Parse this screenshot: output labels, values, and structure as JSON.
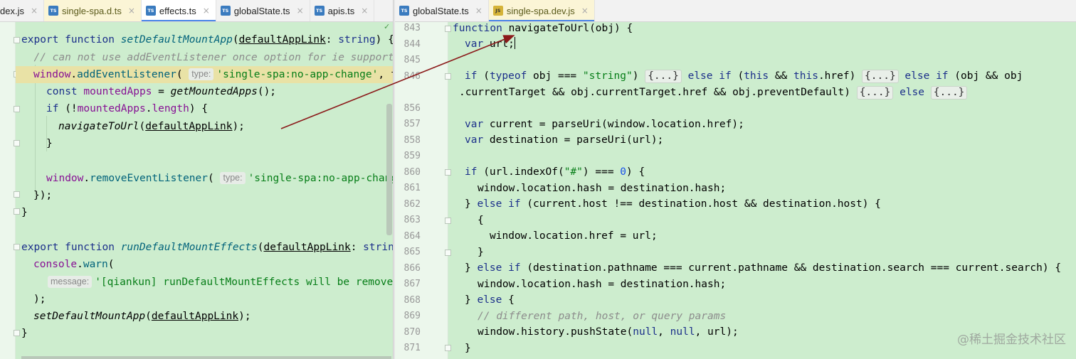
{
  "left_tabs": [
    {
      "label": "dex.js",
      "icon": "js"
    },
    {
      "label": "single-spa.d.ts",
      "icon": "ts"
    },
    {
      "label": "effects.ts",
      "icon": "ts"
    },
    {
      "label": "globalState.ts",
      "icon": "ts"
    },
    {
      "label": "apis.ts",
      "icon": "ts"
    }
  ],
  "right_tabs": [
    {
      "label": "globalState.ts",
      "icon": "ts"
    },
    {
      "label": "single-spa.dev.js",
      "icon": "js"
    }
  ],
  "icons": {
    "ts": "TS",
    "js": "JS",
    "close": "×",
    "check": "✓"
  },
  "left": {
    "l1": {
      "a": "export function ",
      "b": "setDefaultMountApp",
      "c": "(",
      "d": "defaultAppLink",
      "e": ": ",
      "f": "string",
      "g": ") {"
    },
    "l2": "  // can not use addEventListener once option for ie support",
    "l3": {
      "a": "window",
      "b": ".",
      "c": "addEventListener",
      "d": "( ",
      "hint": "type:",
      "e": "'single-spa:no-app-change'",
      "f": ", f"
    },
    "l4": {
      "a": "const ",
      "b": "mountedApps",
      "c": " = ",
      "d": "getMountedApps",
      "e": "();"
    },
    "l5": {
      "a": "if ",
      "b": "(!",
      "c": "mountedApps",
      "d": ".",
      "e": "length",
      "f": ") {"
    },
    "l6": {
      "a": "navigateToUrl",
      "b": "(",
      "c": "defaultAppLink",
      "d": ");"
    },
    "l7": "}",
    "l8": {
      "a": "window",
      "b": ".",
      "c": "removeEventListener",
      "d": "( ",
      "hint": "type:",
      "e": "'single-spa:no-app-change"
    },
    "l9": "});",
    "l10": "}",
    "l11": {
      "a": "export function ",
      "b": "runDefaultMountEffects",
      "c": "(",
      "d": "defaultAppLink",
      "e": ": ",
      "f": "strin"
    },
    "l12": {
      "a": "console",
      "b": ".",
      "c": "warn",
      "d": "("
    },
    "l13": {
      "hint": "message:",
      "a": "'[qiankun] runDefaultMountEffects will be remove"
    },
    "l14": ");",
    "l15": {
      "a": "setDefaultMountApp",
      "b": "(",
      "c": "defaultAppLink",
      "d": ");"
    },
    "l16": "}"
  },
  "right": {
    "line_numbers": [
      "843",
      "844",
      "845",
      "846",
      "",
      "856",
      "857",
      "858",
      "859",
      "860",
      "861",
      "862",
      "863",
      "864",
      "865",
      "866",
      "867",
      "868",
      "869",
      "870",
      "871"
    ],
    "r843": {
      "a": "function ",
      "b": "navigateToUrl(obj) {"
    },
    "r844": {
      "a": "var ",
      "b": "url;"
    },
    "r846": {
      "a": "if ",
      "b": "(",
      "c": "typeof ",
      "d": "obj === ",
      "e": "\"string\"",
      "f": ") ",
      "g": "{...}",
      "h": " else if ",
      "i": "(",
      "j": "this",
      "k": " && ",
      "l": "this",
      "m": ".href) ",
      "n": "{...}",
      "o": " else if ",
      "p": "(obj && obj"
    },
    "r846b": {
      "a": ".currentTarget && obj.currentTarget.href && obj.preventDefault) ",
      "b": "{...}",
      "c": " else ",
      "d": "{...}"
    },
    "r857": {
      "a": "var ",
      "b": "current = parseUri(window.location.href);"
    },
    "r858": {
      "a": "var ",
      "b": "destination = parseUri(url);"
    },
    "r860": {
      "a": "if ",
      "b": "(url.indexOf(",
      "c": "\"#\"",
      "d": ") === ",
      "e": "0",
      "f": ") {"
    },
    "r861": "window.location.hash = destination.hash;",
    "r862": {
      "a": "} ",
      "b": "else if ",
      "c": "(current.host !== destination.host && destination.host) {"
    },
    "r863": "{",
    "r864": "window.location.href = url;",
    "r865": "}",
    "r866": {
      "a": "} ",
      "b": "else if ",
      "c": "(destination.pathname === current.pathname && destination.search === current.search) {"
    },
    "r867": "window.location.hash = destination.hash;",
    "r868": {
      "a": "} ",
      "b": "else ",
      "c": "{"
    },
    "r869": "// different path, host, or query params",
    "r870": {
      "a": "window.history.pushState(",
      "b": "null",
      "c": ", ",
      "d": "null",
      "e": ", url);"
    },
    "r871": "}"
  },
  "watermark": "@稀土掘金技术社区",
  "colors": {
    "editor_bg": "#cdedce",
    "keyword": "#1b2f8a",
    "string": "#067d17",
    "comment": "#8c8c8c",
    "arrow": "#8b1a1a"
  }
}
